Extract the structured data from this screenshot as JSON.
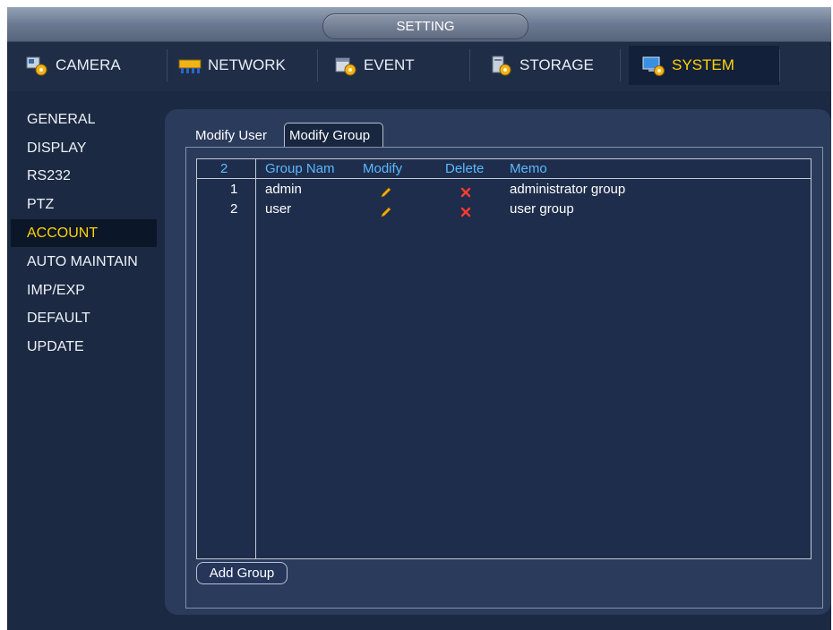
{
  "window": {
    "title": "SETTING"
  },
  "tabs": [
    {
      "label": "CAMERA",
      "icon": "camera-gear-icon"
    },
    {
      "label": "NETWORK",
      "icon": "network-icon"
    },
    {
      "label": "EVENT",
      "icon": "event-icon"
    },
    {
      "label": "STORAGE",
      "icon": "storage-icon"
    },
    {
      "label": "SYSTEM",
      "icon": "system-icon",
      "active": true
    }
  ],
  "sidebar": {
    "items": [
      {
        "label": "GENERAL"
      },
      {
        "label": "DISPLAY"
      },
      {
        "label": "RS232"
      },
      {
        "label": "PTZ"
      },
      {
        "label": "ACCOUNT",
        "active": true
      },
      {
        "label": "AUTO MAINTAIN"
      },
      {
        "label": "IMP/EXP"
      },
      {
        "label": "DEFAULT"
      },
      {
        "label": "UPDATE"
      }
    ]
  },
  "subtabs": [
    {
      "label": "Modify User"
    },
    {
      "label": "Modify Group",
      "active": true
    }
  ],
  "table": {
    "count": "2",
    "headers": [
      "Group Nam",
      "Modify",
      "Delete",
      "Memo"
    ],
    "rows": [
      {
        "index": "1",
        "name": "admin",
        "modify_icon": "pencil-icon",
        "delete_icon": "delete-icon",
        "memo": "administrator group"
      },
      {
        "index": "2",
        "name": "user",
        "modify_icon": "pencil-icon",
        "delete_icon": "delete-icon",
        "memo": "user group"
      }
    ]
  },
  "actions": {
    "add_group": "Add Group"
  },
  "colors": {
    "background": "#1b2942",
    "panel": "#2b3b5c",
    "active_text": "#ffd400",
    "header_text": "#5cb8ff",
    "delete": "#ff3b2f",
    "pencil": "#f6b100"
  }
}
